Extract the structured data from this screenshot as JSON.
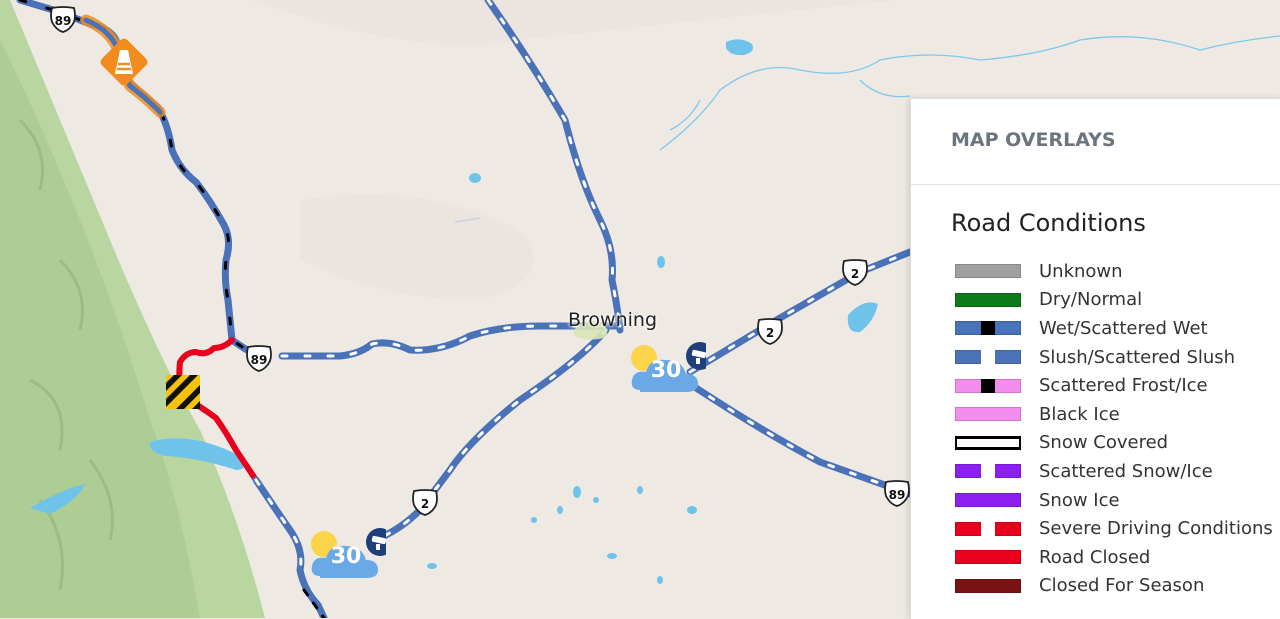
{
  "map": {
    "town_label": "Browning",
    "highway_shields": [
      {
        "id": "us-89-nw",
        "number": "89",
        "type": "us"
      },
      {
        "id": "us-89-w",
        "number": "89",
        "type": "us"
      },
      {
        "id": "us-89-e",
        "number": "89",
        "type": "us"
      },
      {
        "id": "us-2-ne",
        "number": "2",
        "type": "us"
      },
      {
        "id": "us-2-e",
        "number": "2",
        "type": "us"
      },
      {
        "id": "us-2-sw",
        "number": "2",
        "type": "us"
      }
    ],
    "weather_markers": [
      {
        "id": "weather-browning",
        "temperature": "30",
        "condition": "partly-cloudy",
        "camera_icon": "camera-icon"
      },
      {
        "id": "weather-southwest",
        "temperature": "30",
        "condition": "partly-cloudy",
        "camera_icon": "camera-icon"
      }
    ],
    "incident_icons": [
      "construction-cone-icon",
      "road-closed-barrier-icon"
    ],
    "colors": {
      "road_wet_blue": "#4a72b8",
      "road_closed_red": "#e8001c",
      "construction_orange": "#f28c1e",
      "park_green": "#b9d6a0",
      "water": "#6fc3ea",
      "weather_cloud": "#6aa9e6",
      "camera_badge": "#1f3f7a"
    }
  },
  "panel": {
    "title": "MAP OVERLAYS",
    "section_title": "Road Conditions",
    "legend": [
      {
        "label": "Unknown",
        "color": "#a0a0a0",
        "center": null,
        "style": "solid"
      },
      {
        "label": "Dry/Normal",
        "color": "#0f7a1a",
        "center": null,
        "style": "solid"
      },
      {
        "label": "Wet/Scattered Wet",
        "color": "#4a72b8",
        "center": "#000000",
        "style": "center"
      },
      {
        "label": "Slush/Scattered Slush",
        "color": "#4a72b8",
        "center": "#ffffff",
        "style": "center"
      },
      {
        "label": "Scattered Frost/Ice",
        "color": "#f58df0",
        "center": "#000000",
        "style": "center"
      },
      {
        "label": "Black Ice",
        "color": "#f58df0",
        "center": null,
        "style": "solid"
      },
      {
        "label": "Snow Covered",
        "color": "#ffffff",
        "center": "#000000",
        "style": "snow"
      },
      {
        "label": "Scattered Snow/Ice",
        "color": "#8a1ff0",
        "center": "#ffffff",
        "style": "center"
      },
      {
        "label": "Snow Ice",
        "color": "#8a1ff0",
        "center": null,
        "style": "solid"
      },
      {
        "label": "Severe Driving Conditions",
        "color": "#e8001c",
        "center": "#ffffff",
        "style": "center"
      },
      {
        "label": "Road Closed",
        "color": "#e8001c",
        "center": null,
        "style": "solid"
      },
      {
        "label": "Closed For Season",
        "color": "#7a1414",
        "center": null,
        "style": "solid"
      }
    ]
  }
}
